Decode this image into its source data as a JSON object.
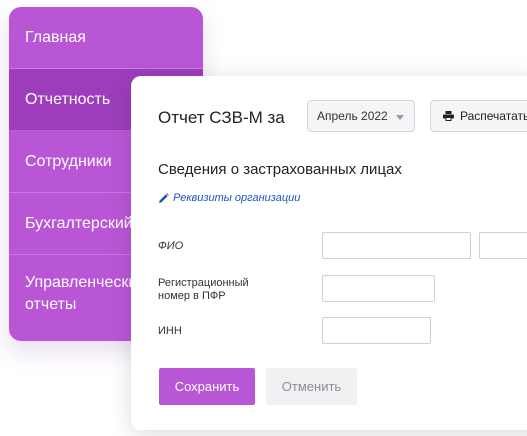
{
  "sidebar": {
    "items": [
      {
        "label": "Главная",
        "active": false
      },
      {
        "label": "Отчетность",
        "active": true
      },
      {
        "label": "Сотрудники",
        "active": false
      },
      {
        "label": "Бухгалтерский учет",
        "active": false
      },
      {
        "label": "Управленческие\nотчеты",
        "active": false
      }
    ]
  },
  "report": {
    "title": "Отчет СЗВ-М за",
    "period": {
      "selected": "Апрель 2022"
    },
    "print_label": "Распечатать",
    "section_title": "Сведения о застрахованных лицах",
    "org_link": "Реквизиты организации",
    "fields": {
      "fio_label": "ФИО",
      "pfr_label": "Регистрационный\nномер в ПФР",
      "inn_label": "ИНН"
    },
    "save_label": "Сохранить",
    "cancel_label": "Отменить"
  },
  "colors": {
    "accent": "#b956d6",
    "accent_dark": "#9d3dbb",
    "link": "#1a56b5"
  },
  "icons": {
    "print": "printer-icon",
    "org_link": "pencil-icon",
    "dropdown": "chevron-down-icon"
  }
}
